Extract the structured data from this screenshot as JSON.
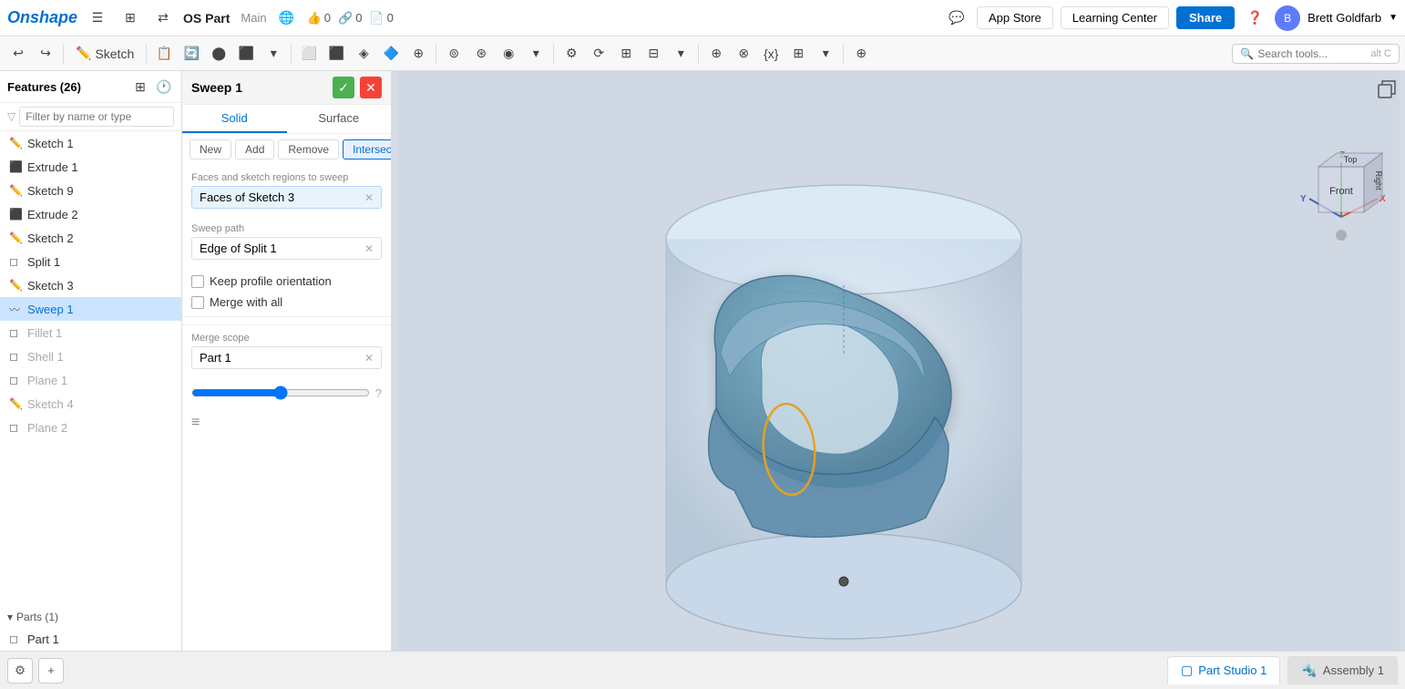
{
  "brand": "Onshape",
  "doc": {
    "title": "OS Part",
    "branch": "Main"
  },
  "nav": {
    "appStore": "App Store",
    "learningCenter": "Learning Center",
    "share": "Share",
    "counters": {
      "likes": "0",
      "links": "0",
      "exports": "0"
    },
    "user": "Brett Goldfarb"
  },
  "toolbar": {
    "sketch": "Sketch",
    "searchPlaceholder": "Search tools...",
    "searchShortcut": "alt C"
  },
  "sidebar": {
    "title": "Features (26)",
    "filterPlaceholder": "Filter by name or type",
    "items": [
      {
        "label": "Sketch 1",
        "icon": "✏️",
        "type": "sketch"
      },
      {
        "label": "Extrude 1",
        "icon": "⬛",
        "type": "extrude"
      },
      {
        "label": "Sketch 9",
        "icon": "✏️",
        "type": "sketch"
      },
      {
        "label": "Extrude 2",
        "icon": "⬛",
        "type": "extrude"
      },
      {
        "label": "Sketch 2",
        "icon": "✏️",
        "type": "sketch"
      },
      {
        "label": "Split 1",
        "icon": "◻",
        "type": "split"
      },
      {
        "label": "Sketch 3",
        "icon": "✏️",
        "type": "sketch"
      },
      {
        "label": "Sweep 1",
        "icon": "〰",
        "type": "sweep",
        "active": true
      },
      {
        "label": "Fillet 1",
        "icon": "◻",
        "type": "fillet",
        "greyed": true
      },
      {
        "label": "Shell 1",
        "icon": "◻",
        "type": "shell",
        "greyed": true
      },
      {
        "label": "Plane 1",
        "icon": "◻",
        "type": "plane",
        "greyed": true
      },
      {
        "label": "Sketch 4",
        "icon": "✏️",
        "type": "sketch",
        "greyed": true
      },
      {
        "label": "Plane 2",
        "icon": "◻",
        "type": "plane",
        "greyed": true
      }
    ],
    "partsSection": "Parts (1)",
    "parts": [
      {
        "label": "Part 1"
      }
    ]
  },
  "sweep": {
    "title": "Sweep 1",
    "tabs": [
      {
        "label": "Solid",
        "active": true
      },
      {
        "label": "Surface",
        "active": false
      }
    ],
    "subtabs": [
      {
        "label": "New",
        "active": false
      },
      {
        "label": "Add",
        "active": false
      },
      {
        "label": "Remove",
        "active": false
      },
      {
        "label": "Intersect",
        "active": true
      }
    ],
    "profileLabel": "Faces and sketch regions to sweep",
    "profileValue": "Faces of Sketch 3",
    "sweepPathLabel": "Sweep path",
    "sweepPathValue": "Edge of Split 1",
    "keepProfileOrientation": "Keep profile orientation",
    "mergeWithAll": "Merge with all",
    "mergeScopeLabel": "Merge scope",
    "mergeScopeValue": "Part 1"
  },
  "bottomTabs": [
    {
      "label": "Part Studio 1",
      "icon": "▢",
      "active": true
    },
    {
      "label": "Assembly 1",
      "icon": "🔩",
      "active": false
    }
  ],
  "colors": {
    "primary": "#0070d2",
    "active_tab": "#cce4ff",
    "sweep_bg": "#e8f4fd",
    "sweep_border": "#b3d4f7"
  }
}
